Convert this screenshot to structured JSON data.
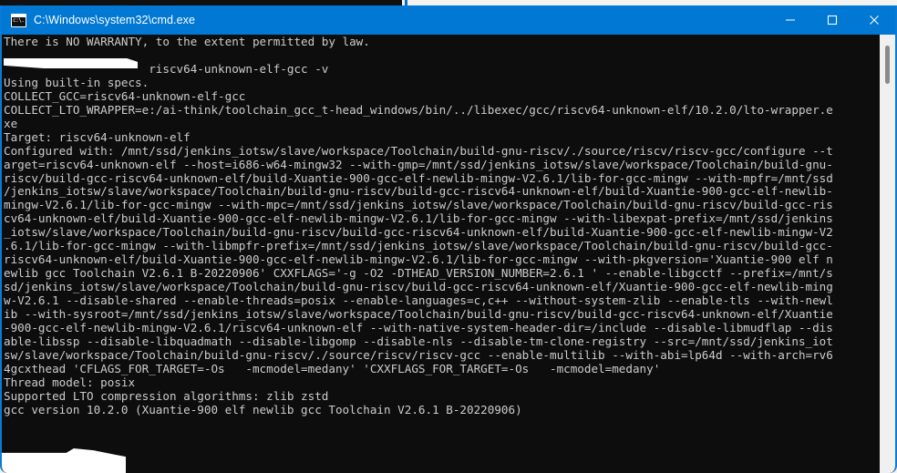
{
  "window": {
    "title": "C:\\Windows\\system32\\cmd.exe",
    "icon": "cmd-console-icon",
    "accent_color": "#0078d4",
    "border_color": "#0a7ad4",
    "background_color": "#0d0d0d",
    "text_color": "#cccccc"
  },
  "titlebar_buttons": {
    "minimize_label": "Minimize",
    "maximize_label": "Maximize",
    "close_label": "Close"
  },
  "scrollbar": {
    "track_color": "#f0f0f0",
    "thumb_color": "#8a8a8a"
  },
  "redactions": {
    "top_label": "redacted-prompt-path",
    "bottom_label": "redacted-prompt-path"
  },
  "console": {
    "text": "There is NO WARRANTY, to the extent permitted by law.\n\n                     riscv64-unknown-elf-gcc -v\nUsing built-in specs.\nCOLLECT_GCC=riscv64-unknown-elf-gcc\nCOLLECT_LTO_WRAPPER=e:/ai-think/toolchain_gcc_t-head_windows/bin/../libexec/gcc/riscv64-unknown-elf/10.2.0/lto-wrapper.e\nxe\nTarget: riscv64-unknown-elf\nConfigured with: /mnt/ssd/jenkins_iotsw/slave/workspace/Toolchain/build-gnu-riscv/./source/riscv/riscv-gcc/configure --t\narget=riscv64-unknown-elf --host=i686-w64-mingw32 --with-gmp=/mnt/ssd/jenkins_iotsw/slave/workspace/Toolchain/build-gnu-\nriscv/build-gcc-riscv64-unknown-elf/build-Xuantie-900-gcc-elf-newlib-mingw-V2.6.1/lib-for-gcc-mingw --with-mpfr=/mnt/ssd\n/jenkins_iotsw/slave/workspace/Toolchain/build-gnu-riscv/build-gcc-riscv64-unknown-elf/build-Xuantie-900-gcc-elf-newlib-\nmingw-V2.6.1/lib-for-gcc-mingw --with-mpc=/mnt/ssd/jenkins_iotsw/slave/workspace/Toolchain/build-gnu-riscv/build-gcc-ris\ncv64-unknown-elf/build-Xuantie-900-gcc-elf-newlib-mingw-V2.6.1/lib-for-gcc-mingw --with-libexpat-prefix=/mnt/ssd/jenkins\n_iotsw/slave/workspace/Toolchain/build-gnu-riscv/build-gcc-riscv64-unknown-elf/build-Xuantie-900-gcc-elf-newlib-mingw-V2\n.6.1/lib-for-gcc-mingw --with-libmpfr-prefix=/mnt/ssd/jenkins_iotsw/slave/workspace/Toolchain/build-gnu-riscv/build-gcc-\nriscv64-unknown-elf/build-Xuantie-900-gcc-elf-newlib-mingw-V2.6.1/lib-for-gcc-mingw --with-pkgversion='Xuantie-900 elf n\newlib gcc Toolchain V2.6.1 B-20220906' CXXFLAGS='-g -O2 -DTHEAD_VERSION_NUMBER=2.6.1 ' --enable-libgcctf --prefix=/mnt/s\nsd/jenkins_iotsw/slave/workspace/Toolchain/build-gnu-riscv/build-gcc-riscv64-unknown-elf/Xuantie-900-gcc-elf-newlib-ming\nw-V2.6.1 --disable-shared --enable-threads=posix --enable-languages=c,c++ --without-system-zlib --enable-tls --with-newl\nib --with-sysroot=/mnt/ssd/jenkins_iotsw/slave/workspace/Toolchain/build-gnu-riscv/build-gcc-riscv64-unknown-elf/Xuantie\n-900-gcc-elf-newlib-mingw-V2.6.1/riscv64-unknown-elf --with-native-system-header-dir=/include --disable-libmudflap --dis\nable-libssp --disable-libquadmath --disable-libgomp --disable-nls --disable-tm-clone-registry --src=/mnt/ssd/jenkins_iot\nsw/slave/workspace/Toolchain/build-gnu-riscv/./source/riscv/riscv-gcc --enable-multilib --with-abi=lp64d --with-arch=rv6\n4gcxthead 'CFLAGS_FOR_TARGET=-Os   -mcmodel=medany' 'CXXFLAGS_FOR_TARGET=-Os   -mcmodel=medany'\nThread model: posix\nSupported LTO compression algorithms: zlib zstd\ngcc version 10.2.0 (Xuantie-900 elf newlib gcc Toolchain V2.6.1 B-20220906)\n\n"
  }
}
